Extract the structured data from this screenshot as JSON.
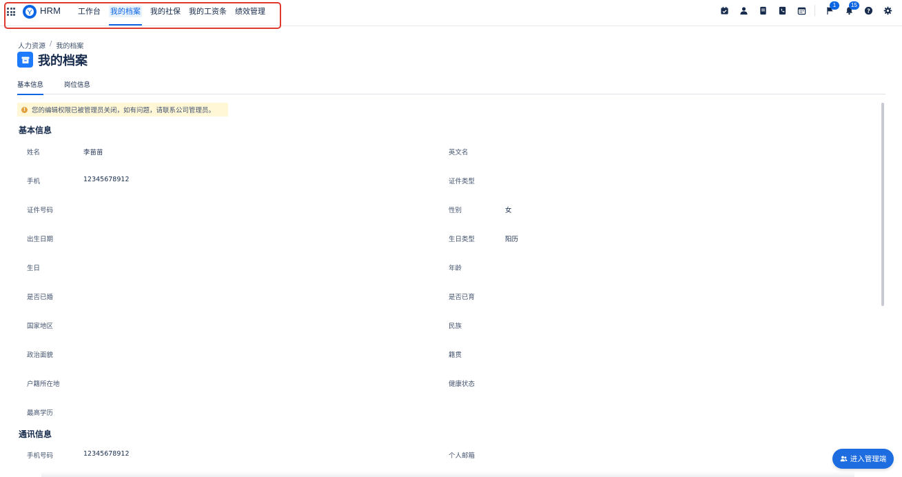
{
  "app": {
    "brand": "HRM"
  },
  "nav": {
    "items": [
      {
        "label": "工作台"
      },
      {
        "label": "我的档案"
      },
      {
        "label": "我的社保"
      },
      {
        "label": "我的工资条"
      },
      {
        "label": "绩效管理"
      }
    ],
    "active_index": 1
  },
  "toolbar": {
    "icons": [
      "calendar-check-icon",
      "person-icon",
      "document-icon",
      "phone-book-icon",
      "calendar-icon",
      "flag-icon",
      "bell-icon",
      "help-icon",
      "gear-icon"
    ],
    "flag_badge": "1",
    "bell_badge": "15"
  },
  "breadcrumb": [
    "人力资源",
    "我的档案"
  ],
  "page_title": "我的档案",
  "tabs": [
    {
      "label": "基本信息"
    },
    {
      "label": "岗位信息"
    }
  ],
  "notice": "您的编辑权限已被管理员关闭，如有问题，请联系公司管理员。",
  "basic_info": {
    "title": "基本信息",
    "left": [
      {
        "label": "姓名",
        "value": "李苗苗"
      },
      {
        "label": "手机",
        "value": "12345678912"
      },
      {
        "label": "证件号码",
        "value": ""
      },
      {
        "label": "出生日期",
        "value": ""
      },
      {
        "label": "生日",
        "value": ""
      },
      {
        "label": "是否已婚",
        "value": ""
      },
      {
        "label": "国家地区",
        "value": ""
      },
      {
        "label": "政治面貌",
        "value": ""
      },
      {
        "label": "户籍所在地",
        "value": ""
      },
      {
        "label": "最高学历",
        "value": ""
      }
    ],
    "right": [
      {
        "label": "英文名",
        "value": ""
      },
      {
        "label": "证件类型",
        "value": ""
      },
      {
        "label": "性别",
        "value": "女"
      },
      {
        "label": "生日类型",
        "value": "阳历"
      },
      {
        "label": "年龄",
        "value": ""
      },
      {
        "label": "是否已育",
        "value": ""
      },
      {
        "label": "民族",
        "value": ""
      },
      {
        "label": "籍贯",
        "value": ""
      },
      {
        "label": "健康状态",
        "value": ""
      }
    ]
  },
  "contact_info": {
    "title": "通讯信息",
    "left": [
      {
        "label": "手机号码",
        "value": "12345678912"
      }
    ],
    "right": [
      {
        "label": "个人邮箱",
        "value": ""
      }
    ]
  },
  "admin_button": "进入管理端",
  "colors": {
    "accent": "#0c66e4",
    "highlight_border": "#e0382c",
    "notice_bg": "#fff7d6",
    "warn": "#e2a03f"
  }
}
